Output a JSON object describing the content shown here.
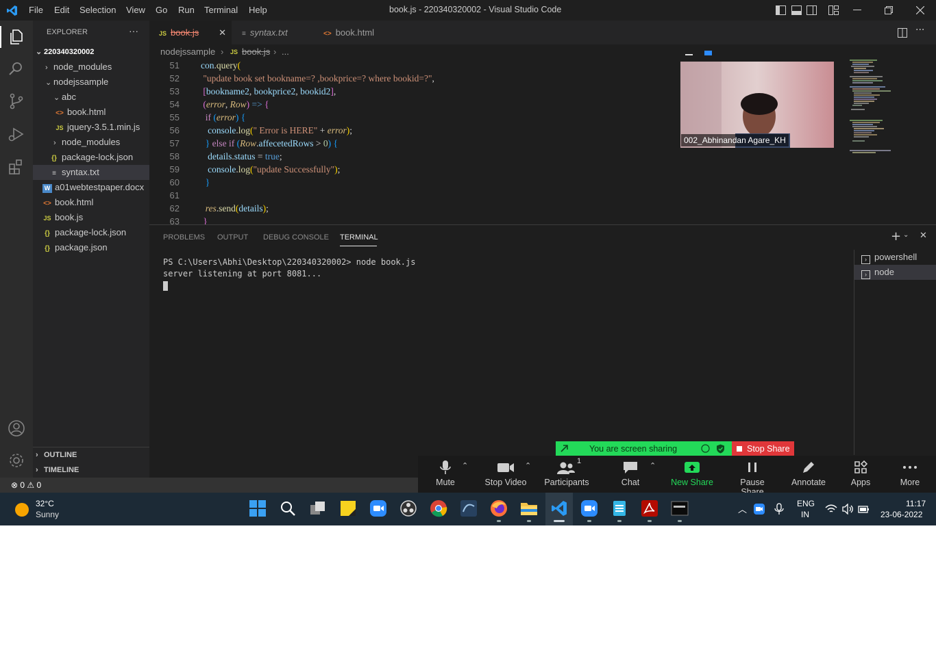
{
  "window": {
    "title": "book.js - 220340320002 - Visual Studio Code"
  },
  "menu": [
    "File",
    "Edit",
    "Selection",
    "View",
    "Go",
    "Run",
    "Terminal",
    "Help"
  ],
  "explorer": {
    "header": "EXPLORER",
    "more": "···",
    "root": "220340320002",
    "items": [
      {
        "label": "node_modules",
        "icon": ""
      },
      {
        "label": "nodejssample",
        "icon": ""
      },
      {
        "label": "abc",
        "icon": ""
      },
      {
        "label": "book.html",
        "icon": "<>"
      },
      {
        "label": "jquery-3.5.1.min.js",
        "icon": "JS"
      },
      {
        "label": "node_modules",
        "icon": ""
      },
      {
        "label": "package-lock.json",
        "icon": "{}"
      },
      {
        "label": "syntax.txt",
        "icon": "≡"
      },
      {
        "label": "a01webtestpaper.docx",
        "icon": "W"
      },
      {
        "label": "book.html",
        "icon": "<>"
      },
      {
        "label": "book.js",
        "icon": "JS"
      },
      {
        "label": "package-lock.json",
        "icon": "{}"
      },
      {
        "label": "package.json",
        "icon": "{}"
      }
    ],
    "outline": "OUTLINE",
    "timeline": "TIMELINE"
  },
  "tabs": [
    {
      "label": "book.js",
      "icon": "JS"
    },
    {
      "label": "syntax.txt",
      "icon": "≡"
    },
    {
      "label": "book.html",
      "icon": "<>"
    }
  ],
  "breadcrumb": {
    "folder": "nodejssample",
    "file": "book.js",
    "more": "..."
  },
  "code": {
    "line_numbers": [
      "51",
      "52",
      "53",
      "54",
      "55",
      "56",
      "57",
      "58",
      "59",
      "60",
      "61",
      "62",
      "63"
    ]
  },
  "panel": {
    "tabs": [
      "PROBLEMS",
      "OUTPUT",
      "DEBUG CONSOLE",
      "TERMINAL"
    ],
    "terminal_lines": [
      "PS C:\\Users\\Abhi\\Desktop\\220340320002> node book.js",
      "server listening at port 8081..."
    ],
    "terminals": [
      "powershell",
      "node"
    ]
  },
  "status": {
    "errors": "0",
    "warnings": "0"
  },
  "zoom": {
    "participant_name": "002_Abhinandan Agare_KH",
    "sharing_text": "You are screen sharing",
    "stop_share": "Stop Share",
    "controls": [
      "Mute",
      "Stop Video",
      "Participants",
      "Chat",
      "New Share",
      "Pause Share",
      "Annotate",
      "Apps",
      "More"
    ],
    "participants_count": "1",
    "accent_green": "#23d959",
    "stop_red": "#e0373a"
  },
  "taskbar": {
    "weather_temp": "32°C",
    "weather_desc": "Sunny",
    "lang": "ENG",
    "region": "IN",
    "time": "11:17",
    "date": "23-06-2022"
  }
}
